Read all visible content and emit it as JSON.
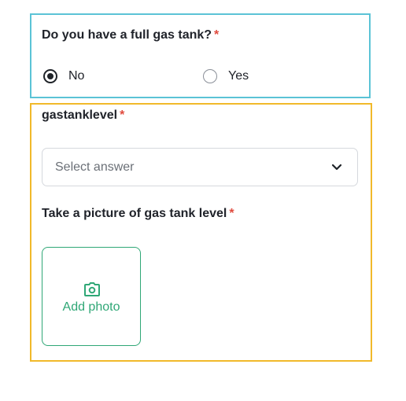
{
  "question": {
    "label": "Do you have a full gas tank?",
    "required_mark": "*",
    "options": [
      {
        "label": "No",
        "selected": true
      },
      {
        "label": "Yes",
        "selected": false
      }
    ]
  },
  "gastanklevel": {
    "label": "gastanklevel",
    "required_mark": "*",
    "placeholder": "Select answer"
  },
  "photo": {
    "label": "Take a picture of gas tank level",
    "required_mark": "*",
    "button_label": "Add photo"
  },
  "colors": {
    "question_highlight": "#5bc3d6",
    "followup_highlight": "#f1b92a",
    "required": "#e04a3d",
    "accent_green": "#2fa776"
  },
  "icons": {
    "dropdown": "chevron-down-icon",
    "photo": "camera-icon"
  }
}
